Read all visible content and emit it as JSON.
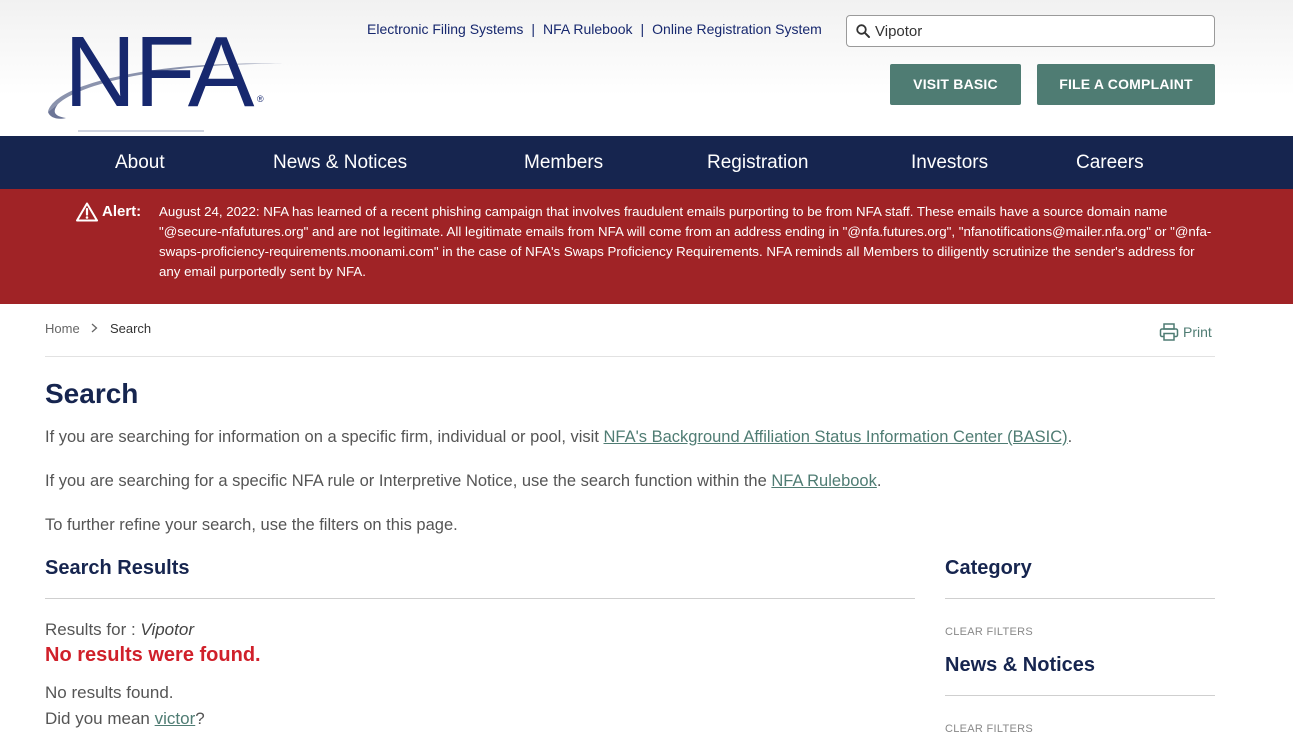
{
  "header": {
    "logo_text": "NFA",
    "logo_reg": "®",
    "top_links": [
      "Electronic Filing Systems",
      "NFA Rulebook",
      "Online Registration System"
    ],
    "separator": "|",
    "search_value": "Vipotor",
    "buttons": {
      "visit_basic": "VISIT BASIC",
      "file_complaint": "FILE A COMPLAINT"
    }
  },
  "nav": {
    "items": [
      "About",
      "News & Notices",
      "Members",
      "Registration",
      "Investors",
      "Careers"
    ]
  },
  "alert": {
    "label": "Alert:",
    "text": "August 24, 2022: NFA has learned of a recent phishing campaign that involves fraudulent emails purporting to be from NFA staff. These emails have a source domain name \"@secure-nfafutures.org\" and are not legitimate. All legitimate emails from NFA will come from an address ending in \"@nfa.futures.org\", \"nfanotifications@mailer.nfa.org\" or \"@nfa-swaps-proficiency-requirements.moonami.com\" in the case of NFA's Swaps Proficiency Requirements. NFA reminds all Members to diligently scrutinize the sender's address for any email purportedly sent by NFA."
  },
  "breadcrumb": {
    "home": "Home",
    "current": "Search"
  },
  "print_label": "Print",
  "main": {
    "title": "Search",
    "p1_before": "If you are searching for information on a specific firm, individual or pool, visit ",
    "p1_link": "NFA's Background Affiliation Status Information Center (BASIC)",
    "p1_after": ".",
    "p2_before": "If you are searching for a specific NFA rule or Interpretive Notice, use the search function within the ",
    "p2_link": "NFA Rulebook",
    "p2_after": ".",
    "p3": "To further refine your search, use the filters on this page.",
    "results_heading": "Search Results",
    "results_for_label": "Results for : ",
    "results_query": "Vipotor",
    "no_results_title": "No results were found.",
    "no_results_text": "No results found.",
    "did_you_mean_before": "Did you mean ",
    "did_you_mean_link": "victor",
    "did_you_mean_after": "?"
  },
  "sidebar": {
    "category_heading": "Category",
    "clear_filters_1": "CLEAR FILTERS",
    "news_heading": "News & Notices",
    "clear_filters_2": "CLEAR FILTERS"
  },
  "colors": {
    "brand_navy": "#16254f",
    "button_teal": "#4f7c73",
    "alert_red": "#a02326",
    "error_red": "#d0202a"
  },
  "icons": [
    "search-icon",
    "warning-icon",
    "chevron-right-icon",
    "printer-icon"
  ]
}
